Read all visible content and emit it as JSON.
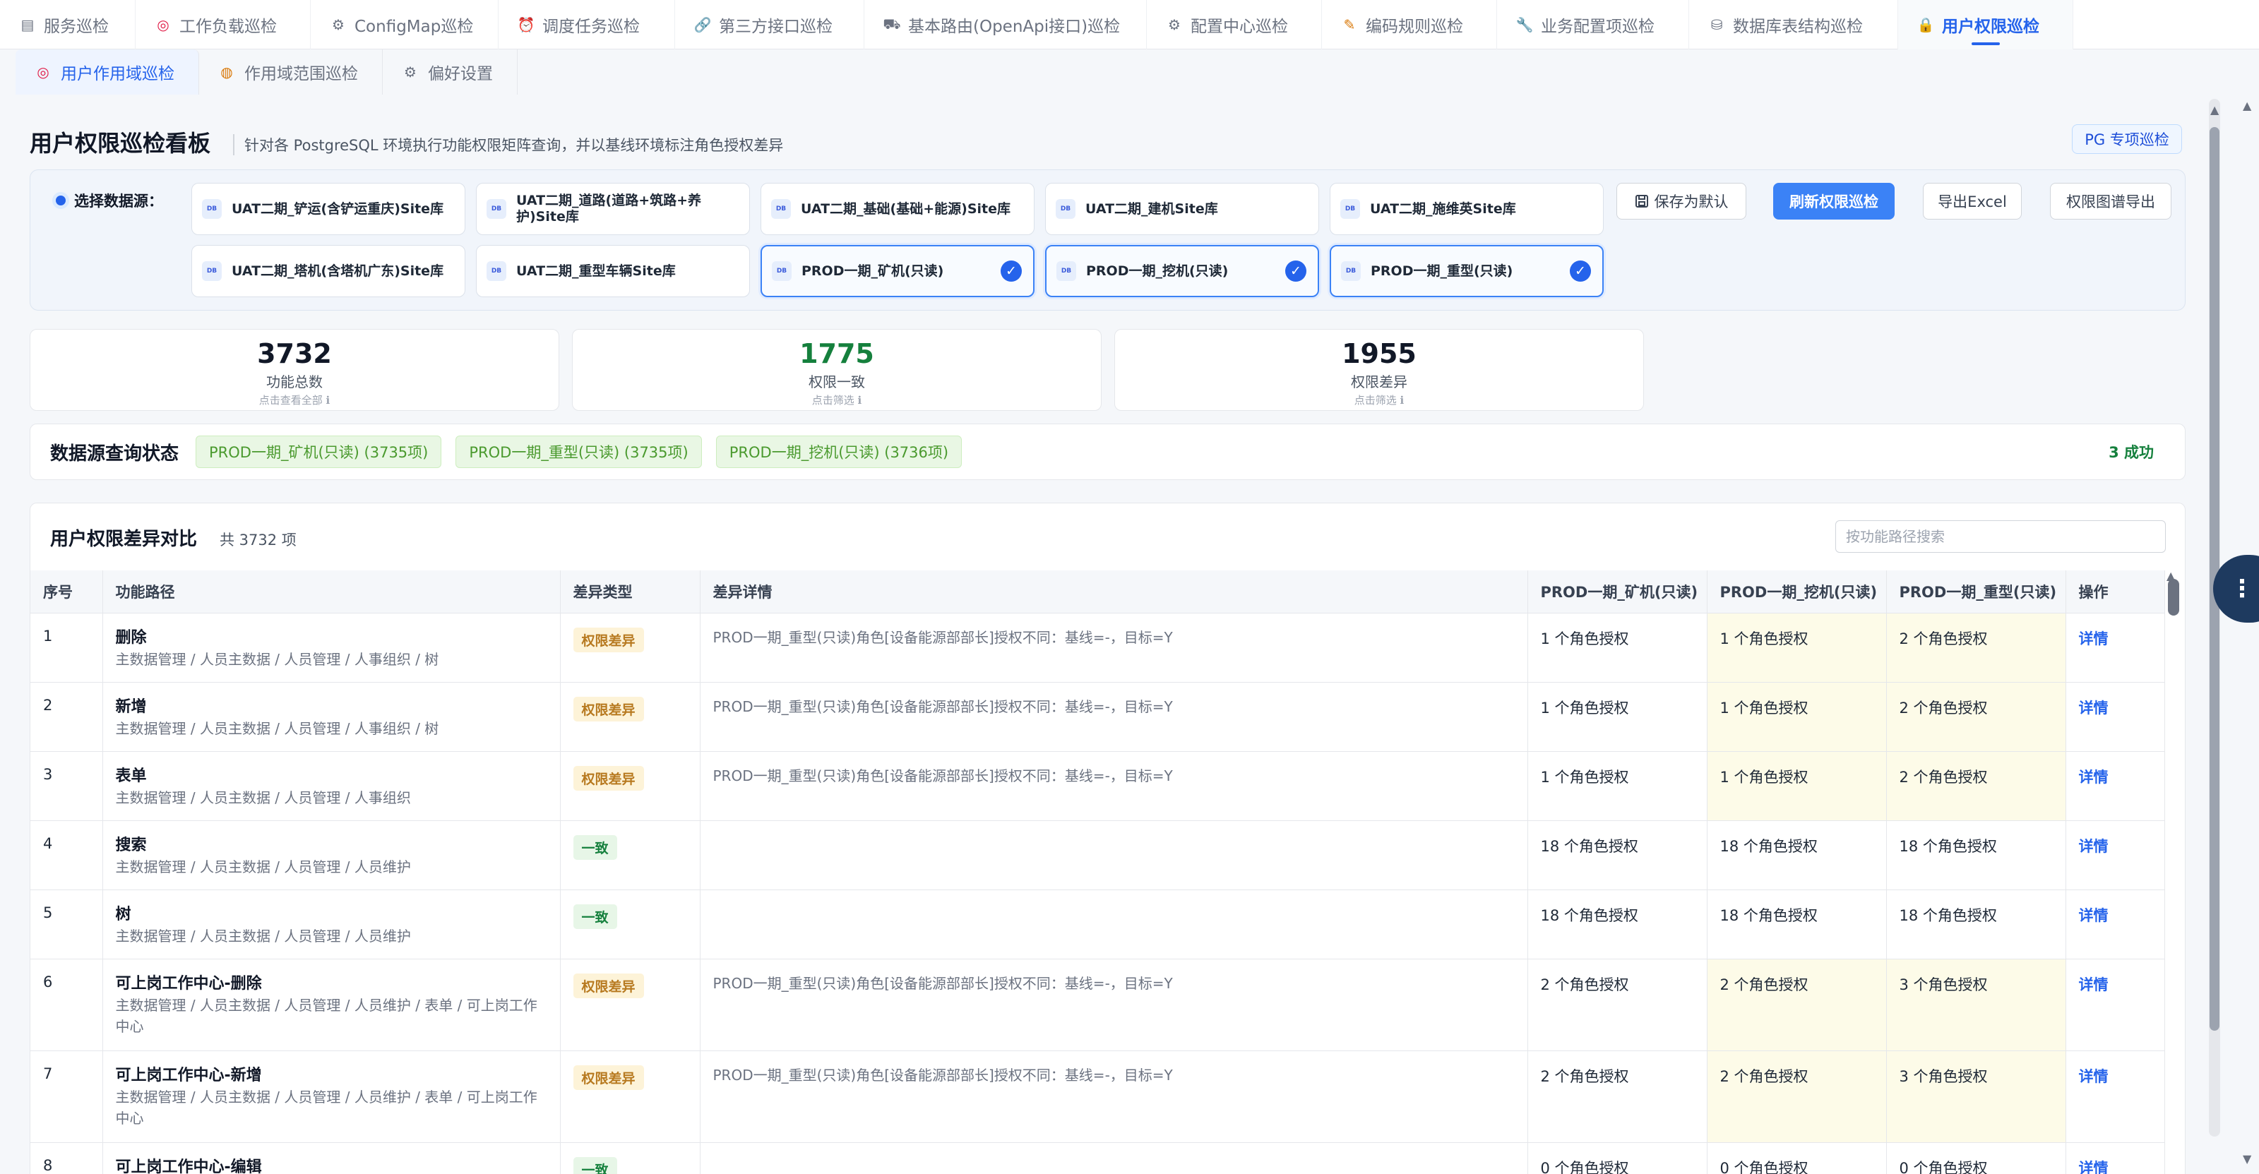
{
  "top_tabs": [
    {
      "label": "服务巡检",
      "icon": "server-icon",
      "glyph": "▤"
    },
    {
      "label": "工作负载巡检",
      "icon": "target-icon",
      "glyph": "◎"
    },
    {
      "label": "ConfigMap巡检",
      "icon": "gear-icon",
      "glyph": "⚙"
    },
    {
      "label": "调度任务巡检",
      "icon": "alarm-clock-icon",
      "glyph": "⏰"
    },
    {
      "label": "第三方接口巡检",
      "icon": "link-icon",
      "glyph": "🔗"
    },
    {
      "label": "基本路由(OpenApi接口)巡检",
      "icon": "road-icon",
      "glyph": "⛟"
    },
    {
      "label": "配置中心巡检",
      "icon": "gear-icon",
      "glyph": "⚙"
    },
    {
      "label": "编码规则巡检",
      "icon": "memo-icon",
      "glyph": "✎"
    },
    {
      "label": "业务配置项巡检",
      "icon": "wrench-icon",
      "glyph": "🔧"
    },
    {
      "label": "数据库表结构巡检",
      "icon": "database-icon",
      "glyph": "⛁"
    },
    {
      "label": "用户权限巡检",
      "icon": "lock-icon",
      "glyph": "🔒"
    }
  ],
  "sub_tabs": [
    {
      "label": "用户作用域巡检",
      "icon": "target-icon",
      "glyph": "◎"
    },
    {
      "label": "作用域范围巡检",
      "icon": "crystal-ball-icon",
      "glyph": "◍"
    },
    {
      "label": "偏好设置",
      "icon": "gear-icon",
      "glyph": "⚙"
    }
  ],
  "header": {
    "title": "用户权限巡检看板",
    "subtitle": "针对各 PostgreSQL 环境执行功能权限矩阵查询，并以基线环境标注角色授权差异",
    "pg_button": "PG 专项巡检"
  },
  "datasource": {
    "label": "选择数据源：",
    "db_icon_text": "DB",
    "check_glyph": "✓",
    "items": [
      {
        "name": "UAT二期_铲运(含铲运重庆)Site库",
        "selected": false
      },
      {
        "name": "UAT二期_道路(道路+筑路+养护)Site库",
        "selected": false
      },
      {
        "name": "UAT二期_基础(基础+能源)Site库",
        "selected": false
      },
      {
        "name": "UAT二期_建机Site库",
        "selected": false
      },
      {
        "name": "UAT二期_施维英Site库",
        "selected": false
      },
      {
        "name": "UAT二期_塔机(含塔机广东)Site库",
        "selected": false
      },
      {
        "name": "UAT二期_重型车辆Site库",
        "selected": false
      },
      {
        "name": "PROD一期_矿机(只读)",
        "selected": true
      },
      {
        "name": "PROD一期_挖机(只读)",
        "selected": true
      },
      {
        "name": "PROD一期_重型(只读)",
        "selected": true
      }
    ],
    "actions": {
      "save_default": "保存为默认",
      "save_icon": "save-icon",
      "refresh": "刷新权限巡检",
      "export_excel": "导出Excel",
      "export_graph": "权限图谱导出"
    }
  },
  "stats": [
    {
      "value": "3732",
      "label": "功能总数",
      "hint": "点击查看全部 ℹ"
    },
    {
      "value": "1775",
      "label": "权限一致",
      "hint": "点击筛选 ℹ"
    },
    {
      "value": "1955",
      "label": "权限差异",
      "hint": "点击筛选 ℹ"
    }
  ],
  "query_status": {
    "title": "数据源查询状态",
    "tags": [
      "PROD一期_矿机(只读) (3735项)",
      "PROD一期_重型(只读) (3735项)",
      "PROD一期_挖机(只读) (3736项)"
    ],
    "success": "3 成功"
  },
  "table": {
    "title": "用户权限差异对比",
    "count": "共 3732 项",
    "search_placeholder": "按功能路径搜索",
    "columns": [
      "序号",
      "功能路径",
      "差异类型",
      "差异详情",
      "PROD一期_矿机(只读)",
      "PROD一期_挖机(只读)",
      "PROD一期_重型(只读)",
      "操作"
    ],
    "rows": [
      {
        "seq": "1",
        "name": "删除",
        "path": "主数据管理 / 人员主数据 / 人员管理 / 人事组织 / 树",
        "type": "权限差异",
        "diff": true,
        "detail": "PROD一期_重型(只读)角色[设备能源部部长]授权不同：基线=-，目标=Y",
        "kuangji": "1 个角色授权",
        "waji": "1 个角色授权",
        "zhongxing": "2 个角色授权",
        "action": "详情"
      },
      {
        "seq": "2",
        "name": "新增",
        "path": "主数据管理 / 人员主数据 / 人员管理 / 人事组织 / 树",
        "type": "权限差异",
        "diff": true,
        "detail": "PROD一期_重型(只读)角色[设备能源部部长]授权不同：基线=-，目标=Y",
        "kuangji": "1 个角色授权",
        "waji": "1 个角色授权",
        "zhongxing": "2 个角色授权",
        "action": "详情"
      },
      {
        "seq": "3",
        "name": "表单",
        "path": "主数据管理 / 人员主数据 / 人员管理 / 人事组织",
        "type": "权限差异",
        "diff": true,
        "detail": "PROD一期_重型(只读)角色[设备能源部部长]授权不同：基线=-，目标=Y",
        "kuangji": "1 个角色授权",
        "waji": "1 个角色授权",
        "zhongxing": "2 个角色授权",
        "action": "详情"
      },
      {
        "seq": "4",
        "name": "搜索",
        "path": "主数据管理 / 人员主数据 / 人员管理 / 人员维护",
        "type": "一致",
        "diff": false,
        "detail": "",
        "kuangji": "18 个角色授权",
        "waji": "18 个角色授权",
        "zhongxing": "18 个角色授权",
        "action": "详情"
      },
      {
        "seq": "5",
        "name": "树",
        "path": "主数据管理 / 人员主数据 / 人员管理 / 人员维护",
        "type": "一致",
        "diff": false,
        "detail": "",
        "kuangji": "18 个角色授权",
        "waji": "18 个角色授权",
        "zhongxing": "18 个角色授权",
        "action": "详情"
      },
      {
        "seq": "6",
        "name": "可上岗工作中心-删除",
        "path": "主数据管理 / 人员主数据 / 人员管理 / 人员维护 / 表单 / 可上岗工作中心",
        "type": "权限差异",
        "diff": true,
        "detail": "PROD一期_重型(只读)角色[设备能源部部长]授权不同：基线=-，目标=Y",
        "kuangji": "2 个角色授权",
        "waji": "2 个角色授权",
        "zhongxing": "3 个角色授权",
        "action": "详情"
      },
      {
        "seq": "7",
        "name": "可上岗工作中心-新增",
        "path": "主数据管理 / 人员主数据 / 人员管理 / 人员维护 / 表单 / 可上岗工作中心",
        "type": "权限差异",
        "diff": true,
        "detail": "PROD一期_重型(只读)角色[设备能源部部长]授权不同：基线=-，目标=Y",
        "kuangji": "2 个角色授权",
        "waji": "2 个角色授权",
        "zhongxing": "3 个角色授权",
        "action": "详情"
      },
      {
        "seq": "8",
        "name": "可上岗工作中心-编辑",
        "path": "",
        "type": "一致",
        "diff": false,
        "detail": "",
        "kuangji": "0 个角色授权",
        "waji": "0 个角色授权",
        "zhongxing": "0 个角色授权",
        "action": "详情"
      }
    ]
  },
  "floating": {
    "more_glyph": "⋮"
  }
}
